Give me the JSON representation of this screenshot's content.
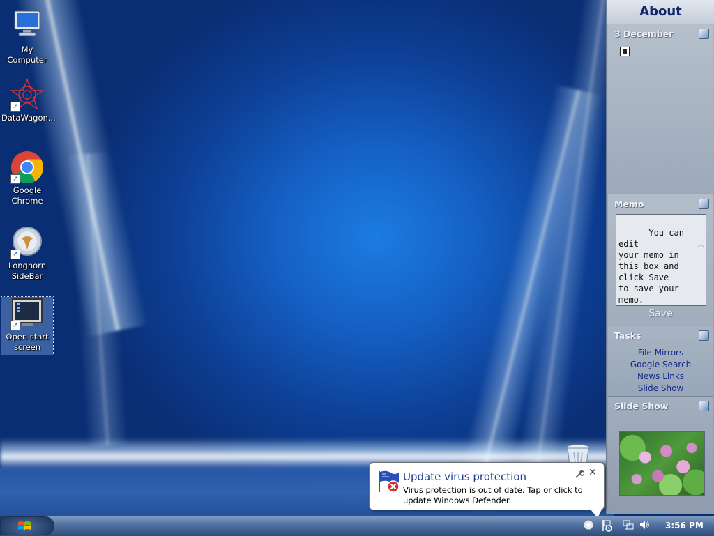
{
  "desktop_icons": [
    {
      "label": "My Computer",
      "icon": "computer-icon"
    },
    {
      "label": "DataWagon...",
      "icon": "datawagon-icon"
    },
    {
      "label": "Google Chrome",
      "icon": "chrome-icon"
    },
    {
      "label": "Longhorn SideBar",
      "icon": "sidebar-app-icon"
    },
    {
      "label": "Open start screen",
      "icon": "monitor-icon"
    }
  ],
  "sidebar": {
    "header": "About",
    "calendar": {
      "title": "3 December"
    },
    "memo": {
      "title": "Memo",
      "text": "You can edit\nyour memo in\nthis box and\nclick Save\nto save your\nmemo.",
      "save_label": "Save"
    },
    "tasks": {
      "title": "Tasks",
      "items": [
        "File Mirrors",
        "Google Search",
        "News Links",
        "Slide Show"
      ]
    },
    "slideshow": {
      "title": "Slide Show"
    }
  },
  "notification": {
    "title": "Update virus protection",
    "body": "Virus protection is out of date. Tap or click to update Windows Defender.",
    "close_glyph": "✕"
  },
  "taskbar": {
    "clock": "3:56 PM"
  },
  "colors": {
    "accent_title": "#1c3f95",
    "sidebar_header_text": "#13236d",
    "task_link": "#142a88"
  }
}
